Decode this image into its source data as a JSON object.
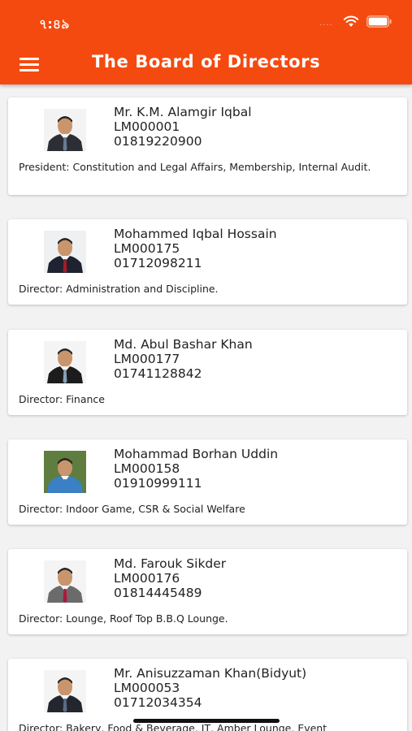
{
  "status_bar": {
    "time": "৭:৪৯",
    "signal": "...."
  },
  "header": {
    "title": "The Board of Directors"
  },
  "directors": [
    {
      "name": "Mr. K.M. Alamgir  Iqbal",
      "member_id": "LM000001",
      "phone": "01819220900",
      "role": "President: Constitution and Legal Affairs, Membership, Internal Audit.",
      "photo_bg": "#f3f3f3",
      "suit": "#2c2e36",
      "tie": "#6b7b8f"
    },
    {
      "name": "Mohammed Iqbal Hossain",
      "member_id": "LM000175",
      "phone": "01712098211",
      "role": "Director: Administration and Discipline.",
      "photo_bg": "#eef0f2",
      "suit": "#1f2230",
      "tie": "#a01e2a"
    },
    {
      "name": "Md. Abul Bashar Khan",
      "member_id": "LM000177",
      "phone": "01741128842",
      "role": "Director: Finance",
      "photo_bg": "#f4f4f4",
      "suit": "#1c1c1c",
      "tie": "#8aa0b8"
    },
    {
      "name": "Mohammad Borhan Uddin",
      "member_id": "LM000158",
      "phone": "01910999111",
      "role": "Director: Indoor Game, CSR & Social Welfare",
      "photo_bg": "#5f7d3f",
      "suit": "#3b7fc4",
      "tie": "#3b7fc4"
    },
    {
      "name": "Md. Farouk Sikder",
      "member_id": "LM000176",
      "phone": "01814445489",
      "role": "Director: Lounge, Roof Top B.B.Q Lounge.",
      "photo_bg": "#f4f4f4",
      "suit": "#6b6b6b",
      "tie": "#b0163a"
    },
    {
      "name": "Mr. Anisuzzaman Khan(Bidyut)",
      "member_id": "LM000053",
      "phone": "01712034354",
      "role": "Director: Bakery, Food & Beverage, IT, Amber Lounge, Event",
      "photo_bg": "#f4f4f4",
      "suit": "#23262e",
      "tie": "#5c6b86"
    }
  ]
}
